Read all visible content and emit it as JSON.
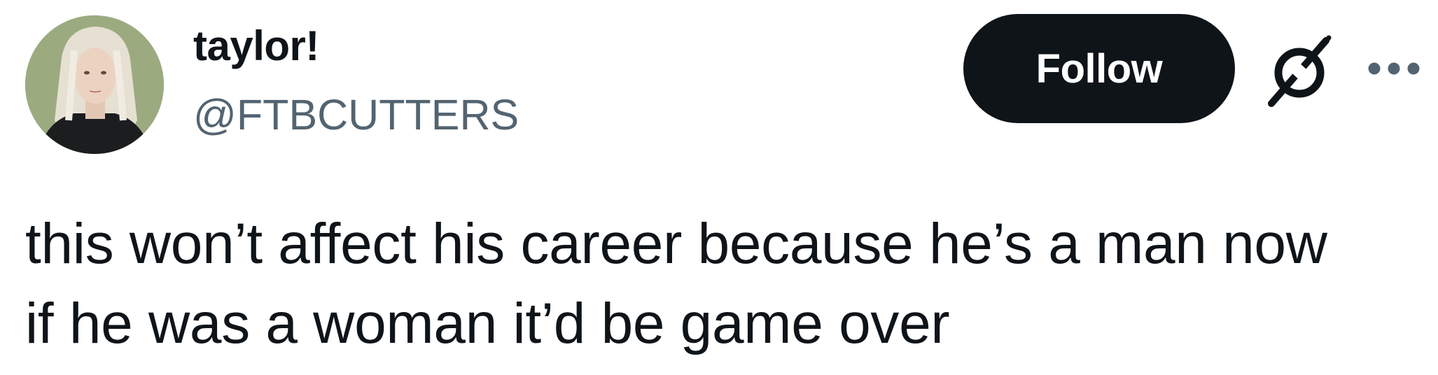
{
  "author": {
    "display_name": "taylor!",
    "handle": "@FTBCUTTERS",
    "avatar_icon": "profile-photo"
  },
  "actions": {
    "follow_label": "Follow",
    "grok_icon": "grok-icon",
    "more_icon": "more-options-icon"
  },
  "tweet": {
    "lines": [
      "this won’t affect his career because he’s a man now",
      "if he was a woman it’d be game over"
    ]
  },
  "colors": {
    "text_primary": "#0f1419",
    "text_secondary": "#536471",
    "button_bg": "#0f1419",
    "button_text": "#ffffff",
    "background": "#ffffff"
  }
}
